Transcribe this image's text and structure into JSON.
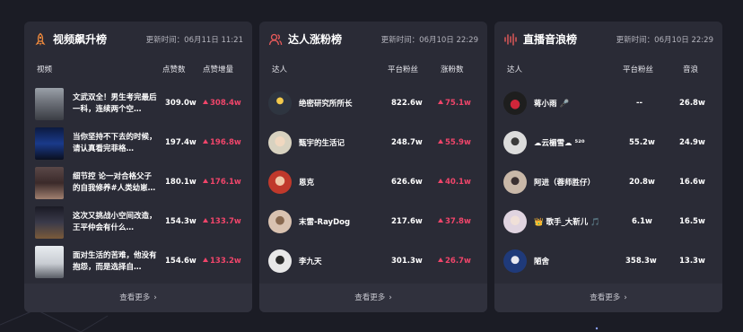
{
  "colors": {
    "background": "#1b1c25",
    "card": "#2a2b36",
    "accent_pink": "#f0456a",
    "icon_orange": "#f08a3c",
    "icon_red": "#e65a5a"
  },
  "cards": [
    {
      "title": "视频飙升榜",
      "time": "更新时间：06月11日 11:21",
      "icon": "rocket-icon",
      "columns": [
        "视频",
        "点赞数",
        "点赞增量"
      ],
      "rows": [
        {
          "title": "文武双全！男生考完最后一科，连续两个空…",
          "value": "309.0w",
          "delta": "308.4w",
          "thumb_color": "#6c7078"
        },
        {
          "title": "当你坚持不下去的时候，请认真看完菲格…",
          "value": "197.4w",
          "delta": "196.8w",
          "thumb_color": "#1a3a8a"
        },
        {
          "title": "细节控 论一对合格父子的自我修养#人类幼崽…",
          "value": "180.1w",
          "delta": "176.1w",
          "thumb_color": "#3b2a2a"
        },
        {
          "title": "这次又挑战小空间改造，王平仲会有什么…",
          "value": "154.3w",
          "delta": "133.7w",
          "thumb_color": "#2a2a3a"
        },
        {
          "title": "面对生活的苦难，他没有抱怨，而是选择自…",
          "value": "154.6w",
          "delta": "133.2w",
          "thumb_color": "#c8ccd2"
        }
      ],
      "more": "查看更多"
    },
    {
      "title": "达人涨粉榜",
      "time": "更新时间：06月10日 22:29",
      "icon": "user-icon",
      "columns": [
        "达人",
        "平台粉丝",
        "涨粉数"
      ],
      "rows": [
        {
          "name": "绝密研究所所长",
          "value": "822.6w",
          "delta": "75.1w",
          "avatar_color": "#2e3540"
        },
        {
          "name": "甄宇的生活记",
          "value": "248.7w",
          "delta": "55.9w",
          "avatar_color": "#d8d2c0"
        },
        {
          "name": "恩克",
          "value": "626.6w",
          "delta": "40.1w",
          "avatar_color": "#c0392b"
        },
        {
          "name": "末雷-RayDog",
          "value": "217.6w",
          "delta": "37.8w",
          "avatar_color": "#d9c2b0"
        },
        {
          "name": "李九天",
          "value": "301.3w",
          "delta": "26.7w",
          "avatar_color": "#e8e8e8"
        }
      ],
      "more": "查看更多"
    },
    {
      "title": "直播音浪榜",
      "time": "更新时间：06月10日 22:29",
      "icon": "soundwave-icon",
      "columns": [
        "达人",
        "平台粉丝",
        "音浪"
      ],
      "rows": [
        {
          "name": "蒋小雨 🎤",
          "value": "--",
          "delta": "26.8w",
          "avatar_color": "#222"
        },
        {
          "name": "☁云楣雪☁ ⁵²⁰",
          "value": "55.2w",
          "delta": "24.9w",
          "avatar_color": "#dcdcdc"
        },
        {
          "name": "阿进（蓉师胜仔）",
          "value": "20.8w",
          "delta": "16.6w",
          "avatar_color": "#c9b8a8"
        },
        {
          "name": "👑 歌手_大靳儿 🎵",
          "value": "6.1w",
          "delta": "16.5w",
          "avatar_color": "#e0d4e0"
        },
        {
          "name": "陋舍",
          "value": "358.3w",
          "delta": "13.3w",
          "avatar_color": "#1f3a7a"
        }
      ],
      "more": "查看更多"
    }
  ]
}
